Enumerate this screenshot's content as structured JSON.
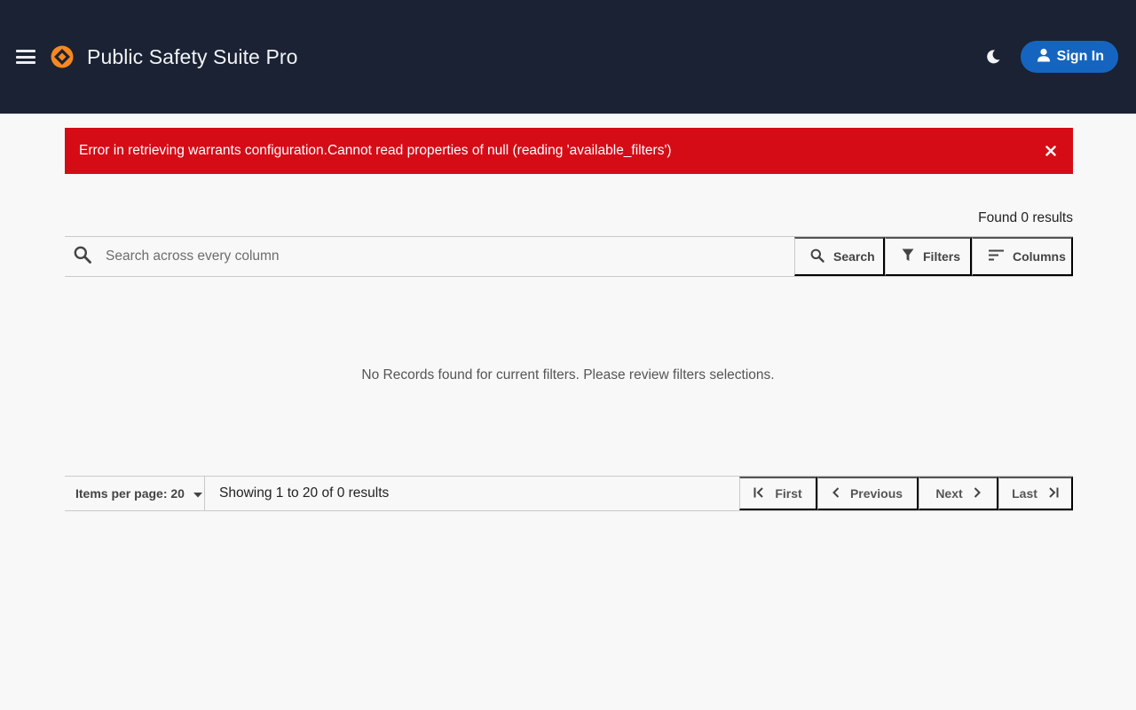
{
  "header": {
    "title": "Public Safety Suite Pro",
    "signin_label": "Sign In",
    "colors": {
      "background": "#1a2233",
      "signin": "#1565c0",
      "logo": "#f7881f"
    }
  },
  "alert": {
    "message": "Error in retrieving warrants configuration.Cannot read properties of null (reading 'available_filters')",
    "color": "#d50c16"
  },
  "results": {
    "found_text": "Found 0 results",
    "empty_message": "No Records found for current filters. Please review filters selections."
  },
  "search": {
    "placeholder": "Search across every column",
    "value": "",
    "search_label": "Search",
    "filters_label": "Filters",
    "columns_label": "Columns"
  },
  "pagination": {
    "items_per_page": "Items per page: 20",
    "showing": "Showing 1 to 20 of 0 results",
    "first": "First",
    "previous": "Previous",
    "next": "Next",
    "last": "Last"
  },
  "icons": [
    "menu-icon",
    "logo-icon",
    "moon-icon",
    "user-icon",
    "close-icon",
    "search-icon",
    "filter-icon",
    "columns-icon",
    "dropdown-icon",
    "first-page-icon",
    "chevron-left-icon",
    "chevron-right-icon",
    "last-page-icon"
  ]
}
